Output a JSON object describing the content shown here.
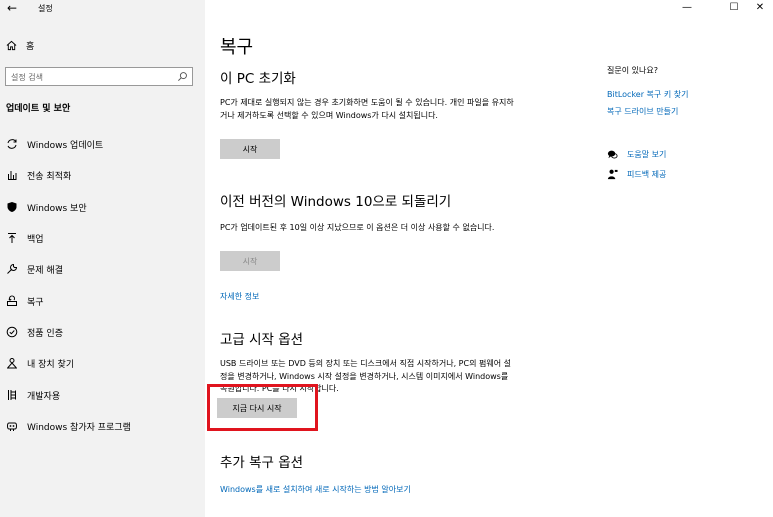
{
  "window": {
    "title": "설정",
    "back_icon": "back-arrow-icon",
    "controls": [
      "minimize-icon",
      "maximize-icon",
      "close-icon"
    ]
  },
  "sidebar": {
    "home_label": "홈",
    "search_placeholder": "설정 검색",
    "section_heading": "업데이트 및 보안",
    "items": [
      {
        "label": "Windows 업데이트",
        "icon": "sync-icon"
      },
      {
        "label": "전송 최적화",
        "icon": "delivery-optimization-icon"
      },
      {
        "label": "Windows 보안",
        "icon": "shield-icon"
      },
      {
        "label": "백업",
        "icon": "backup-arrow-icon"
      },
      {
        "label": "문제 해결",
        "icon": "wrench-icon"
      },
      {
        "label": "복구",
        "icon": "recovery-icon"
      },
      {
        "label": "정품 인증",
        "icon": "activation-check-icon"
      },
      {
        "label": "내 장치 찾기",
        "icon": "person-pin-icon"
      },
      {
        "label": "개발자용",
        "icon": "developer-icon"
      },
      {
        "label": "Windows 참가자 프로그램",
        "icon": "insider-icon"
      }
    ]
  },
  "main": {
    "title": "복구",
    "reset": {
      "heading": "이 PC 초기화",
      "description": "PC가 제대로 실행되지 않는 경우 초기화하면 도움이 될 수 있습니다. 개인 파일을 유지하거나 제거하도록 선택할 수 있으며 Windows가 다시 설치됩니다.",
      "button": "시작"
    },
    "goback": {
      "heading": "이전 버전의 Windows 10으로 되돌리기",
      "description": "PC가 업데이트된 후 10일 이상 지났으므로 이 옵션은 더 이상 사용할 수 없습니다.",
      "button": "시작",
      "link": "자세한 정보"
    },
    "advanced": {
      "heading": "고급 시작 옵션",
      "description": "USB 드라이브 또는 DVD 등의 장치 또는 디스크에서 직접 시작하거나, PC의 펌웨어 설정을 변경하거나, Windows 시작 설정을 변경하거나, 시스템 이미지에서 Windows를 복원합니다. PC를 다시 시작합니다.",
      "button": "지금 다시 시작"
    },
    "more": {
      "heading": "추가 복구 옵션",
      "link": "Windows를 새로 설치하여 새로 시작하는 방법 알아보기"
    }
  },
  "right_panel": {
    "question": "질문이 있나요?",
    "links": [
      "BitLocker 복구 키 찾기",
      "복구 드라이브 만들기"
    ],
    "help": "도움말 보기",
    "feedback": "피드백 제공"
  },
  "colors": {
    "accent": "#0067b8",
    "sidebar_bg": "#f2f2f2",
    "button_bg": "#cccccc",
    "highlight": "#e0141e"
  }
}
